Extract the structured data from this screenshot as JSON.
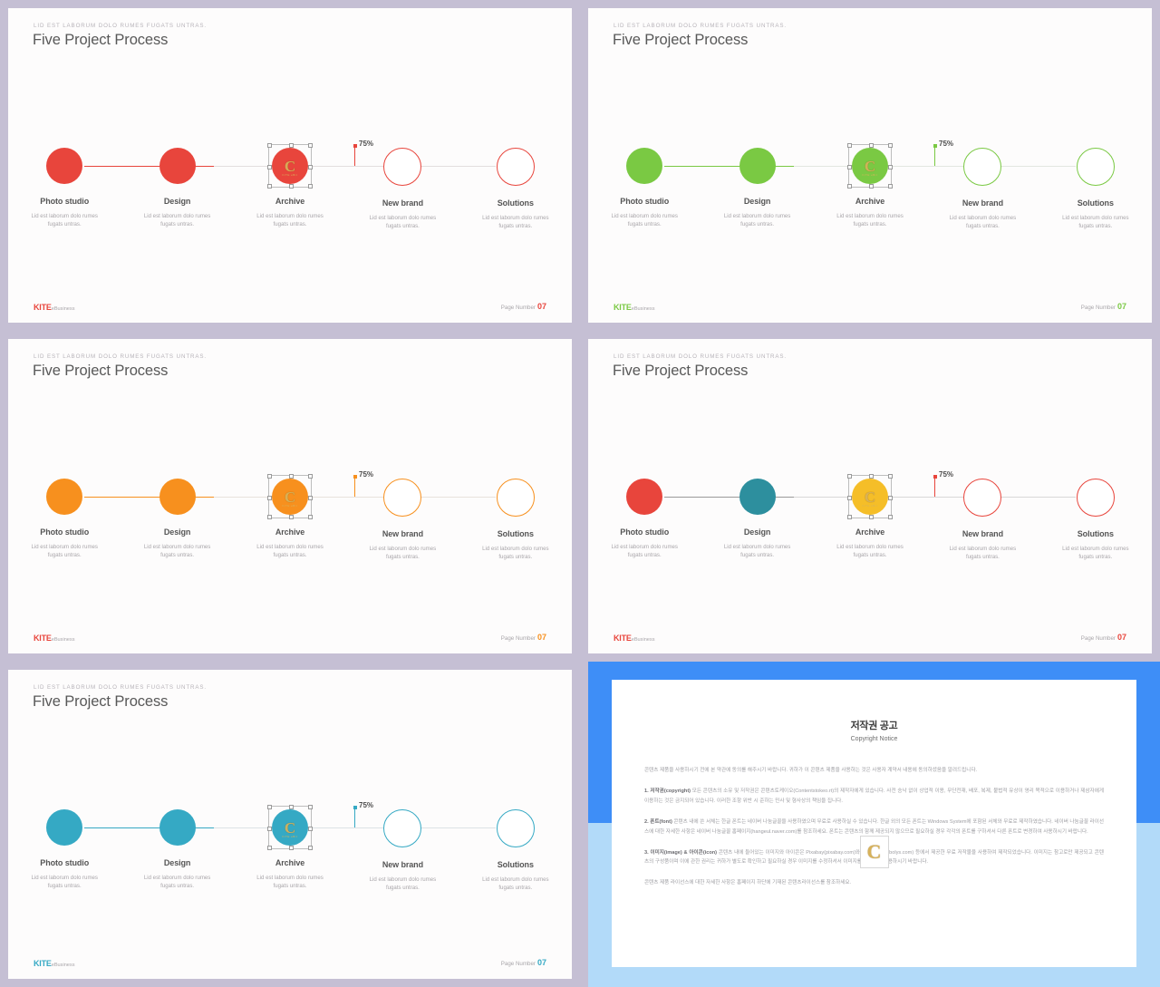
{
  "theme": {
    "separator_color": "#c5bfd4",
    "slide_bg": "#fdfcfc",
    "red": "#e8453c",
    "green": "#7ac943",
    "orange": "#f7901e",
    "teal": "#35a9c4",
    "design_teal": "#2d8f9e",
    "yellow": "#f5be28",
    "gray_line": "#9a9a9a",
    "panel_blue_top": "#3e8ef7",
    "panel_blue_bottom": "#b2daf9",
    "title_color": "#585858",
    "body_color": "#a9a6aa"
  },
  "slide_common": {
    "eyebrow": "LID EST LABORUM  DOLO  RUMES  FUGATS  UNTRAS.",
    "title": "Five Project Process",
    "callout_percent": "75%",
    "footer_logo_main": "KITE",
    "footer_logo_suffix": "eBusiness",
    "footer_page_label": "Page Number",
    "footer_page_number": "07",
    "watermark_letter": "C",
    "watermark_sub": "KITE eBiz",
    "steps": [
      {
        "label": "Photo studio",
        "desc": "Lid est laborum dolo rumes fugats untras."
      },
      {
        "label": "Design",
        "desc": "Lid est laborum dolo rumes fugats untras."
      },
      {
        "label": "Archive",
        "desc": "Lid est laborum dolo rumes fugats untras."
      },
      {
        "label": "New brand",
        "desc": "Lid est laborum dolo rumes fugats untras."
      },
      {
        "label": "Solutions",
        "desc": "Lid est laborum dolo rumes fugats untras."
      }
    ]
  },
  "slides": [
    {
      "id": "slide-red",
      "accent": "#e8453c",
      "line": "#e8453c",
      "track": "#e3dede",
      "page_num_color": "#e8453c",
      "circle_fills": [
        "#e8453c",
        "#e8453c",
        "#e8453c",
        null,
        null
      ],
      "circle_strokes": [
        "#e8453c",
        "#e8453c",
        "#e8453c",
        "#e8453c",
        "#e8453c"
      ]
    },
    {
      "id": "slide-green",
      "accent": "#7ac943",
      "line": "#7ac943",
      "track": "#e3e6e0",
      "page_num_color": "#7ac943",
      "circle_fills": [
        "#7ac943",
        "#7ac943",
        "#7ac943",
        null,
        null
      ],
      "circle_strokes": [
        "#7ac943",
        "#7ac943",
        "#7ac943",
        "#7ac943",
        "#7ac943"
      ]
    },
    {
      "id": "slide-orange",
      "accent": "#f7901e",
      "line": "#f7901e",
      "track": "#e8e2dc",
      "page_num_color": "#f7901e",
      "circle_fills": [
        "#f7901e",
        "#f7901e",
        "#f7901e",
        null,
        null
      ],
      "circle_strokes": [
        "#f7901e",
        "#f7901e",
        "#f7901e",
        "#f7901e",
        "#f7901e"
      ]
    },
    {
      "id": "slide-multi",
      "accent": "#e8453c",
      "line": "#9a9a9a",
      "track": "#d8d8d8",
      "page_num_color": "#e8453c",
      "circle_fills": [
        "#e8453c",
        "#2d8f9e",
        "#f5be28",
        null,
        null
      ],
      "circle_strokes": [
        "#e8453c",
        "#2d8f9e",
        "#f5be28",
        "#e8453c",
        "#e8453c"
      ]
    },
    {
      "id": "slide-teal",
      "accent": "#35a9c4",
      "line": "#35a9c4",
      "track": "#dde3e5",
      "page_num_color": "#35a9c4",
      "circle_fills": [
        "#35a9c4",
        "#35a9c4",
        "#35a9c4",
        null,
        null
      ],
      "circle_strokes": [
        "#35a9c4",
        "#35a9c4",
        "#35a9c4",
        "#35a9c4",
        "#35a9c4"
      ]
    }
  ],
  "copyright": {
    "title_ko": "저작권 공고",
    "title_en": "Copyright Notice",
    "intro": "콘텐츠 제품을 사용하시기 전에 본 약관에 동의를 해주시기 바랍니다. 귀하가 이 콘텐츠 제품을 사용하는 것은 사용자 계약서 내용에 동의하셨음을 알려드립니다.",
    "section1_head": "1. 저작권(copyright)",
    "section1_body": " 모든 콘텐츠의 소유 및 저작권은 콘텐츠토케이오(Contentstokeo.rt)의 제작자에게 있습니다. 사전 승낙 없이 상업적 이용, 무단전재, 배포, 복제, 불법적 유상이 영리 목적으로 이용하거나 제삼자에게 이용하는 것은 금지되어 있습니다. 이러한 조항 위반 시 준하는 민사 및 형사상의 책임을 집니다.",
    "section2_head": "2. 폰트(font)",
    "section2_body": " 콘텐츠 내에 쓴 서체는 한글 폰트는 네이버 나눔글꼴을 사용하였으며 무료로 사용하실 수 있습니다. 한글 외의 모든 폰트는 Windows System에 포함된 서체와 무료로 제작하였습니다. 네이버 나눔글꼴 라이선스에 대한 자세한 사항은 네이버 나눔글꼴 홈페이지(hangeul.naver.com)를 참조하세요. 폰트는 콘텐츠의 함께 제공되지 않으므로 필요하실 경우 각각의 폰트를 구하셔서 다른 폰트로 변경하여 사용하시기 바랍니다.",
    "section3_head": "3. 이미지(image) & 아이콘(icon)",
    "section3_body": " 콘텐츠 내에 들어있는 이미지와 아이콘은 Pixabay(pixabay.com)와 Webolys(webolys.com) 등에서 제공한 무료 저작물을 사용하여 제작되었습니다. 이미지는 참고로만 제공되고 콘텐츠의 구성품이며 이에 관한 권리는 귀하가 별도로 확인하고 필요하실 경우 이미지를 수정하셔서 이미지를 변경하여 사용하시기 바랍니다.",
    "outro": "콘텐츠 제품 라이선스에 대한 자세한 사항은 홈페이지 하단에 기재된 콘텐츠라이선스를 참조하세요.",
    "watermark_letter": "C"
  }
}
